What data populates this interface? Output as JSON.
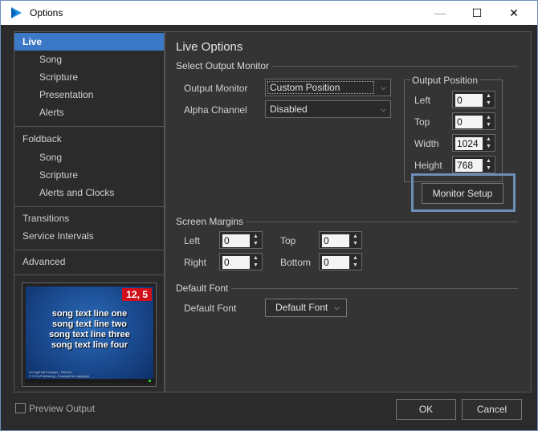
{
  "window": {
    "title": "Options",
    "min_glyph": "—",
    "max_glyph": "☐",
    "close_glyph": "✕"
  },
  "nav": {
    "items": [
      {
        "label": "Live",
        "level": "top",
        "selected": true
      },
      {
        "label": "Song",
        "level": "sub"
      },
      {
        "label": "Scripture",
        "level": "sub"
      },
      {
        "label": "Presentation",
        "level": "sub"
      },
      {
        "label": "Alerts",
        "level": "sub"
      },
      {
        "label": "Foldback",
        "level": "top"
      },
      {
        "label": "Song",
        "level": "sub"
      },
      {
        "label": "Scripture",
        "level": "sub"
      },
      {
        "label": "Alerts and Clocks",
        "level": "sub"
      },
      {
        "label": "Transitions",
        "level": "top"
      },
      {
        "label": "Service Intervals",
        "level": "top"
      },
      {
        "label": "Advanced",
        "level": "top"
      }
    ]
  },
  "preview": {
    "badge": "12, 5",
    "lines": [
      "song text line one",
      "song text line two",
      "song text line three",
      "song text line four"
    ],
    "footer_line1": "No right fall example - Ref line",
    "footer_line2": "© CCLI/Publishing - Example for copyright"
  },
  "main": {
    "title": "Live Options",
    "select_output_monitor": {
      "heading": "Select Output Monitor",
      "output_monitor_label": "Output Monitor",
      "output_monitor_value": "Custom Position",
      "alpha_channel_label": "Alpha Channel",
      "alpha_channel_value": "Disabled"
    },
    "output_position": {
      "heading": "Output Position",
      "left_label": "Left",
      "left_value": "0",
      "top_label": "Top",
      "top_value": "0",
      "width_label": "Width",
      "width_value": "1024",
      "height_label": "Height",
      "height_value": "768",
      "monitor_setup_label": "Monitor Setup"
    },
    "screen_margins": {
      "heading": "Screen Margins",
      "left_label": "Left",
      "left_value": "0",
      "top_label": "Top",
      "top_value": "0",
      "right_label": "Right",
      "right_value": "0",
      "bottom_label": "Bottom",
      "bottom_value": "0"
    },
    "default_font": {
      "heading": "Default Font",
      "label": "Default Font",
      "button_label": "Default Font"
    }
  },
  "footer": {
    "preview_output_label": "Preview Output",
    "ok_label": "OK",
    "cancel_label": "Cancel"
  },
  "colors": {
    "accent": "#3c78c8",
    "focus_border": "#6c8fb8",
    "badge": "#d0101a"
  }
}
